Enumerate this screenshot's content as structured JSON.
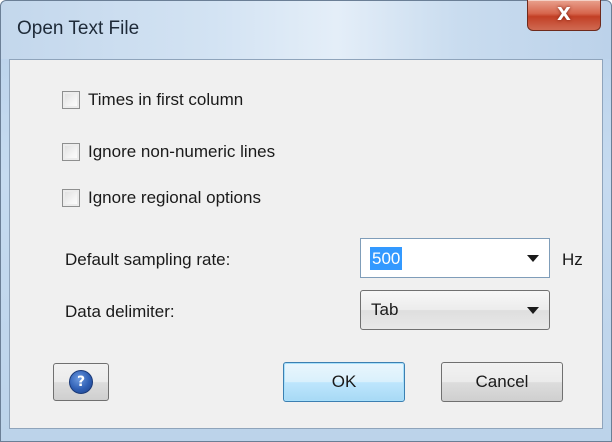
{
  "window": {
    "title": "Open Text File",
    "close_glyph": "X"
  },
  "options": [
    {
      "label": "Times in first column",
      "checked": false
    },
    {
      "label": "Ignore non-numeric lines",
      "checked": false
    },
    {
      "label": "Ignore regional options",
      "checked": false
    }
  ],
  "sampling": {
    "label": "Default sampling rate:",
    "value": "500",
    "unit": "Hz"
  },
  "delimiter": {
    "label": "Data delimiter:",
    "value": "Tab"
  },
  "buttons": {
    "help_glyph": "?",
    "ok_label": "OK",
    "cancel_label": "Cancel"
  },
  "colors": {
    "selection": "#3399ff",
    "close_button": "#c9472c",
    "help_icon": "#2f5fb4"
  }
}
